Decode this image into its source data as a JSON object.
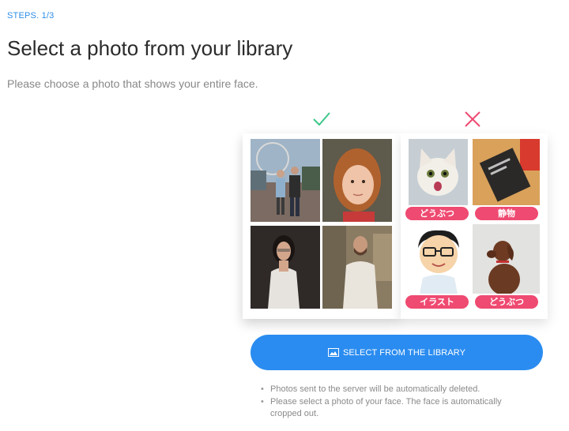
{
  "header": {
    "steps": "STEPS. 1/3",
    "title": "Select a photo from your library",
    "subtitle": "Please choose a photo that shows your entire face."
  },
  "examples": {
    "good_icon": "check-icon",
    "bad_icon": "cross-icon",
    "good_color": "#3ec78a",
    "bad_color": "#ef4a71",
    "bad_labels": [
      "どうぶつ",
      "静物",
      "イラスト",
      "どうぶつ"
    ]
  },
  "action": {
    "button_label": "SELECT FROM THE LIBRARY",
    "button_icon": "image-icon"
  },
  "notes": [
    "Photos sent to the server will be automatically deleted.",
    "Please select a photo of your face. The face is automatically cropped out."
  ]
}
